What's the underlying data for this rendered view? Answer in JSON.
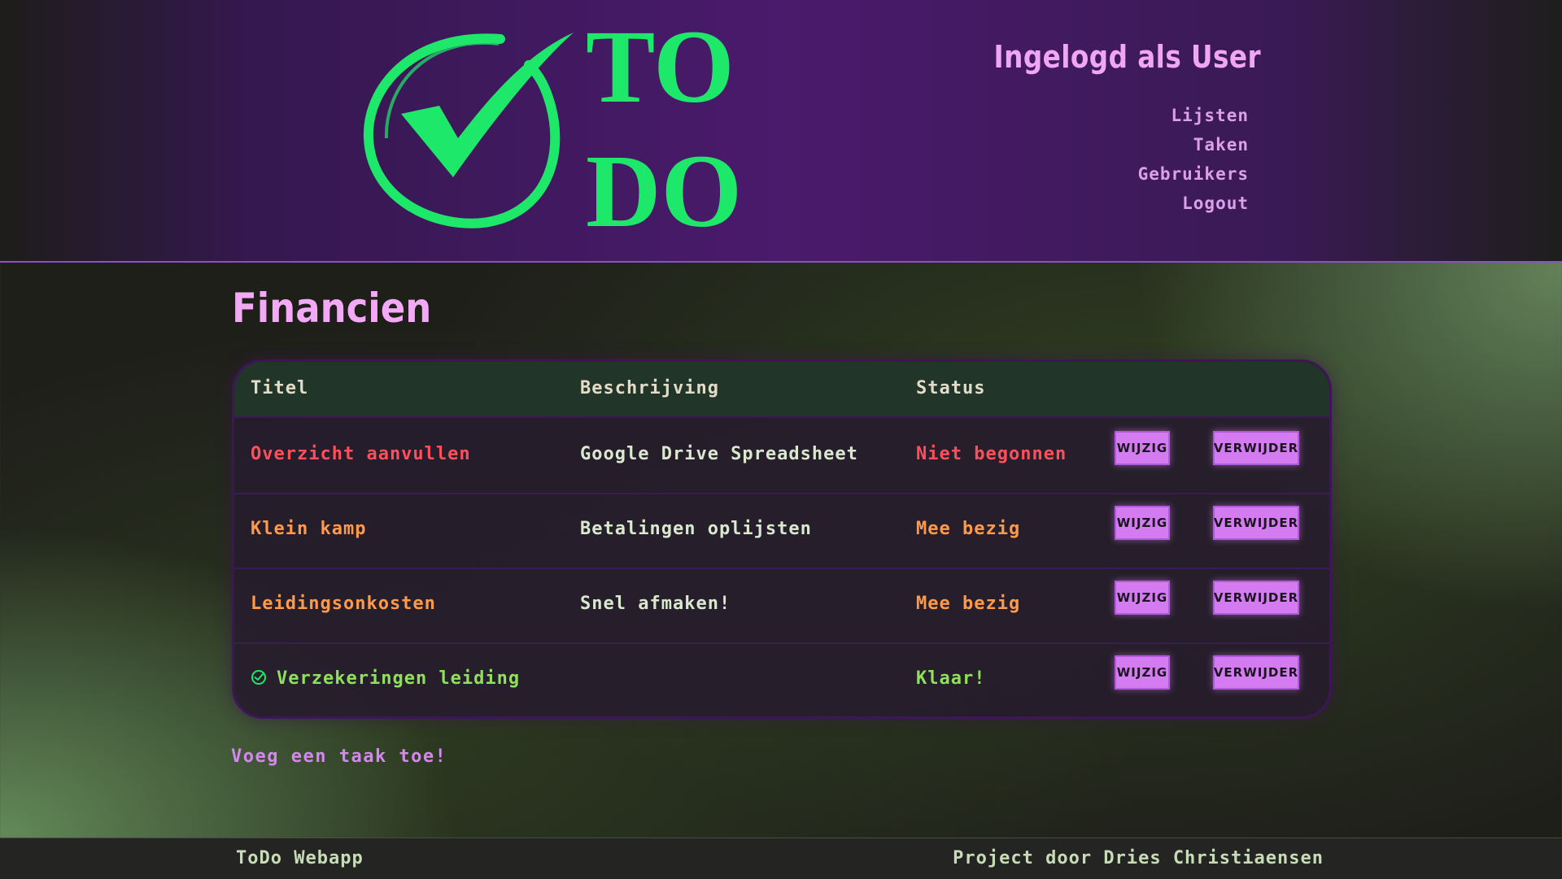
{
  "colors": {
    "accent": "#f0a6f4",
    "logo_green": "#1ee86a",
    "status_not_started": "#ff4f5a",
    "status_in_progress": "#ff9a4a",
    "status_done": "#8fe05a",
    "button_bg": "#d47bf2"
  },
  "header": {
    "logo": {
      "line1": "TO",
      "line2": "DO",
      "icon": "checkmark-circle-icon"
    },
    "user_title": "Ingelogd als User",
    "nav": [
      "Lijsten",
      "Taken",
      "Gebruikers",
      "Logout"
    ]
  },
  "main": {
    "title": "Financien",
    "columns": [
      "Titel",
      "Beschrijving",
      "Status"
    ],
    "rows": [
      {
        "title": "Overzicht aanvullen",
        "description": "Google Drive Spreadsheet",
        "status": "Niet begonnen",
        "state": "not_started",
        "edit": "WIJZIG",
        "delete": "VERWIJDER"
      },
      {
        "title": "Klein kamp",
        "description": "Betalingen oplijsten",
        "status": "Mee bezig",
        "state": "in_progress",
        "edit": "WIJZIG",
        "delete": "VERWIJDER"
      },
      {
        "title": "Leidingsonkosten",
        "description": "Snel afmaken!",
        "status": "Mee bezig",
        "state": "in_progress",
        "edit": "WIJZIG",
        "delete": "VERWIJDER"
      },
      {
        "title": "Verzekeringen leiding",
        "description": "",
        "status": "Klaar!",
        "state": "done",
        "icon": "check-circle-icon",
        "edit": "WIJZIG",
        "delete": "VERWIJDER"
      }
    ],
    "add_link": "Voeg een taak toe!"
  },
  "footer": {
    "left": "ToDo Webapp",
    "right": "Project door Dries Christiaensen"
  }
}
